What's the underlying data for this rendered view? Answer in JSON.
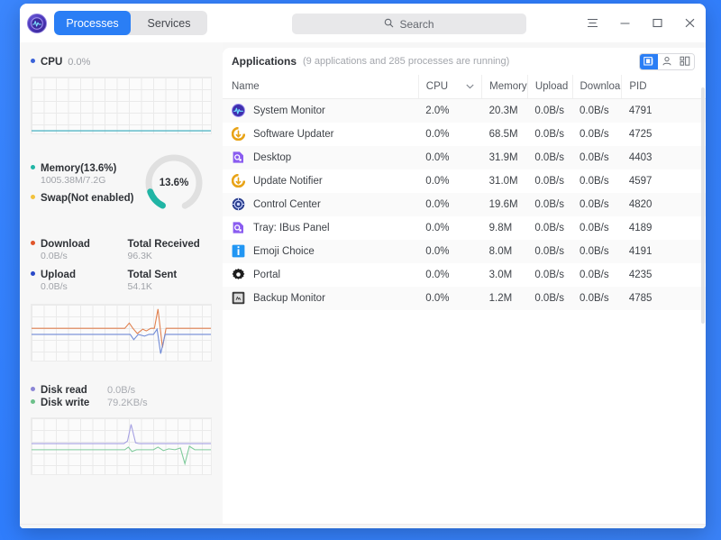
{
  "window": {
    "tabs": [
      {
        "label": "Processes",
        "active": true
      },
      {
        "label": "Services",
        "active": false
      }
    ],
    "search": {
      "placeholder": "Search",
      "value": ""
    },
    "controls": {
      "menu": "menu-icon",
      "minimize": "minimize-icon",
      "maximize": "maximize-icon",
      "close": "close-icon"
    },
    "logo_icon": "system-monitor-logo-icon"
  },
  "sidebar": {
    "cpu": {
      "label": "CPU",
      "value": "0.0%",
      "color": "#3a62d8",
      "line_color": "#56b7c6"
    },
    "memory": {
      "label": "Memory(13.6%)",
      "detail": "1005.38M/7.2G",
      "color": "#21b5a5",
      "gauge_text": "13.6%",
      "gauge_percent": 13.6
    },
    "swap": {
      "label": "Swap(Not enabled)",
      "color": "#f2c23d"
    },
    "network": {
      "download": {
        "label": "Download",
        "value": "0.0B/s",
        "color": "#e0552a"
      },
      "upload": {
        "label": "Upload",
        "value": "0.0B/s",
        "color": "#2a49c8"
      },
      "total_received": {
        "label": "Total Received",
        "value": "96.3K"
      },
      "total_sent": {
        "label": "Total Sent",
        "value": "54.1K"
      }
    },
    "disk": {
      "read": {
        "label": "Disk read",
        "value": "0.0B/s",
        "color": "#8b86d6"
      },
      "write": {
        "label": "Disk write",
        "value": "79.2KB/s",
        "color": "#6cc08a"
      }
    }
  },
  "main": {
    "section_title": "Applications",
    "section_count": "(9 applications and 285 processes are running)",
    "view_toggle": [
      {
        "name": "applications-view-icon",
        "active": true
      },
      {
        "name": "my-processes-view-icon",
        "active": false
      },
      {
        "name": "all-processes-view-icon",
        "active": false
      }
    ],
    "columns": [
      "Name",
      "CPU",
      "Memory",
      "Upload",
      "Downloa",
      "PID"
    ],
    "sort_column": "CPU",
    "sort_direction": "desc",
    "rows": [
      {
        "icon": "system-monitor-icon",
        "name": "System Monitor",
        "cpu": "2.0%",
        "memory": "20.3M",
        "upload": "0.0B/s",
        "download": "0.0B/s",
        "pid": "4791"
      },
      {
        "icon": "software-updater-icon",
        "name": "Software Updater",
        "cpu": "0.0%",
        "memory": "68.5M",
        "upload": "0.0B/s",
        "download": "0.0B/s",
        "pid": "4725"
      },
      {
        "icon": "desktop-icon",
        "name": "Desktop",
        "cpu": "0.0%",
        "memory": "31.9M",
        "upload": "0.0B/s",
        "download": "0.0B/s",
        "pid": "4403"
      },
      {
        "icon": "update-notifier-icon",
        "name": "Update Notifier",
        "cpu": "0.0%",
        "memory": "31.0M",
        "upload": "0.0B/s",
        "download": "0.0B/s",
        "pid": "4597"
      },
      {
        "icon": "control-center-icon",
        "name": "Control Center",
        "cpu": "0.0%",
        "memory": "19.6M",
        "upload": "0.0B/s",
        "download": "0.0B/s",
        "pid": "4820"
      },
      {
        "icon": "ibus-panel-icon",
        "name": "Tray: IBus Panel",
        "cpu": "0.0%",
        "memory": "9.8M",
        "upload": "0.0B/s",
        "download": "0.0B/s",
        "pid": "4189"
      },
      {
        "icon": "emoji-choice-icon",
        "name": "Emoji Choice",
        "cpu": "0.0%",
        "memory": "8.0M",
        "upload": "0.0B/s",
        "download": "0.0B/s",
        "pid": "4191"
      },
      {
        "icon": "portal-icon",
        "name": "Portal",
        "cpu": "0.0%",
        "memory": "3.0M",
        "upload": "0.0B/s",
        "download": "0.0B/s",
        "pid": "4235"
      },
      {
        "icon": "backup-monitor-icon",
        "name": "Backup Monitor",
        "cpu": "0.0%",
        "memory": "1.2M",
        "upload": "0.0B/s",
        "download": "0.0B/s",
        "pid": "4785"
      }
    ]
  }
}
